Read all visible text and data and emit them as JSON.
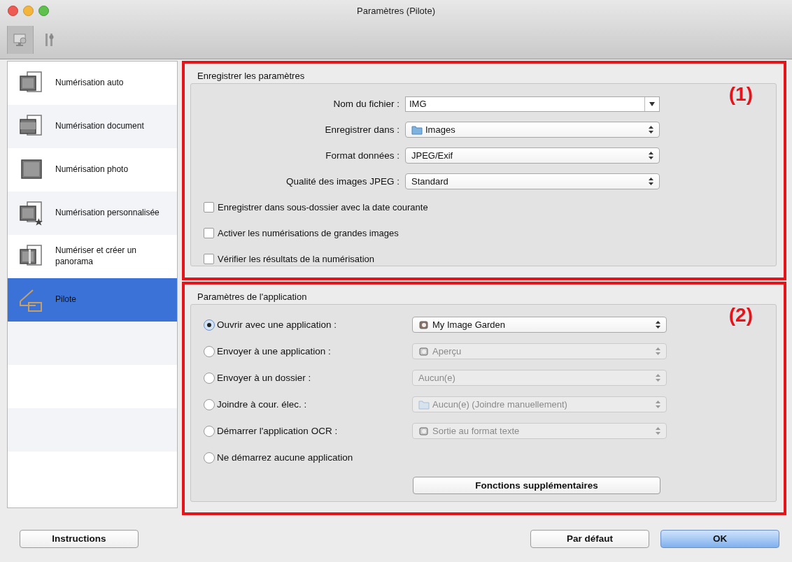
{
  "window": {
    "title": "Paramètres (Pilote)"
  },
  "toolbar": [
    {
      "selected": true
    },
    {
      "selected": false
    }
  ],
  "sidebar": {
    "items": [
      {
        "label": "Numérisation auto",
        "selected": false
      },
      {
        "label": "Numérisation document",
        "selected": false
      },
      {
        "label": "Numérisation photo",
        "selected": false
      },
      {
        "label": "Numérisation personnalisée",
        "selected": false
      },
      {
        "label": "Numériser et créer un panorama",
        "selected": false
      },
      {
        "label": "Pilote",
        "selected": true
      }
    ]
  },
  "save_settings": {
    "title": "Enregistrer les paramètres",
    "annotation": "(1)",
    "fields": [
      {
        "label": "Nom du fichier :",
        "kind": "combo",
        "value": "IMG"
      },
      {
        "label": "Enregistrer dans :",
        "kind": "popup",
        "value": "Images",
        "icon": true
      },
      {
        "label": "Format données :",
        "kind": "popup",
        "value": "JPEG/Exif"
      },
      {
        "label": "Qualité des images JPEG :",
        "kind": "popup",
        "value": "Standard"
      }
    ],
    "checkboxes": [
      {
        "label": "Enregistrer dans sous-dossier avec la date courante",
        "checked": false
      },
      {
        "label": "Activer les numérisations de grandes images",
        "checked": false
      },
      {
        "label": "Vérifier les résultats de la numérisation",
        "checked": false
      }
    ]
  },
  "app_settings": {
    "title": "Paramètres de l'application",
    "annotation": "(2)",
    "options": [
      {
        "label": "Ouvrir avec une application :",
        "selected": true,
        "value": "My Image Garden",
        "disabled": false,
        "icon": true
      },
      {
        "label": "Envoyer à une application :",
        "selected": false,
        "value": "Aperçu",
        "disabled": true,
        "icon": true
      },
      {
        "label": "Envoyer à un dossier :",
        "selected": false,
        "value": "Aucun(e)",
        "disabled": true,
        "icon": false
      },
      {
        "label": "Joindre à cour. élec. :",
        "selected": false,
        "value": "Aucun(e) (Joindre manuellement)",
        "disabled": true,
        "icon": true
      },
      {
        "label": "Démarrer l'application OCR :",
        "selected": false,
        "value": "Sortie au format texte",
        "disabled": true,
        "icon": true
      },
      {
        "label": "Ne démarrez aucune application",
        "selected": false
      }
    ],
    "button": "Fonctions supplémentaires"
  },
  "buttons": [
    {
      "label": "Instructions",
      "default": false
    },
    {
      "label": "Par défaut",
      "default": false
    },
    {
      "label": "OK",
      "default": true
    }
  ]
}
